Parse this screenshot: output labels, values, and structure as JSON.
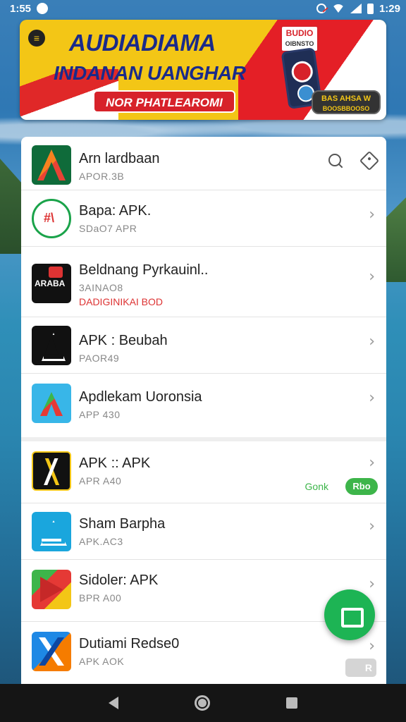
{
  "status_bar": {
    "time": "1:55",
    "clock_right": "1:29"
  },
  "banner": {
    "title": "AUDIADIAMA",
    "subtitle": "INDANAN UANGHAR",
    "pill": "NOR PHATLEAROMI",
    "badge_top": "BUDIO",
    "badge_bottom": "OIBNSTO",
    "cta_top": "BAS AHSA W",
    "cta_bottom": "BOOSBBOOSO"
  },
  "apps": [
    {
      "name": "Arn lardbaan",
      "sub": "APOR.3B",
      "icon": "a-logo-icon"
    },
    {
      "name": "Bapa: APK.",
      "sub": "SDaO7 APR",
      "icon": "circle-logo-icon"
    },
    {
      "name": "Beldnang Pyrkauinl..",
      "sub": "3AINAO8",
      "sub2": "DADIGINIKAI BOD",
      "icon": "araba-logo-icon"
    },
    {
      "name": "APK : Beubah",
      "sub": "PAOR49",
      "icon": "triangle-logo-icon"
    },
    {
      "name": "Apdlekam Uoronsia",
      "sub": "APP 430",
      "icon": "maps-logo-icon"
    },
    {
      "name": "APK :: APK",
      "sub": "APR A40",
      "get_label": "Gonk",
      "get_pill": "Rbo",
      "icon": "cross-logo-icon"
    },
    {
      "name": "Sham Barpha",
      "sub": "APK.AC3",
      "icon": "prism-logo-icon"
    },
    {
      "name": "Sidoler: APK",
      "sub": "BPR A00",
      "icon": "play-logo-icon"
    },
    {
      "name": "Dutiami Redse0",
      "sub": "APK AOK",
      "icon": "x-logo-icon"
    }
  ],
  "mini_badge": "R",
  "colors": {
    "accent_green": "#1db454",
    "banner_yellow": "#f3c616",
    "banner_red": "#e41f26"
  }
}
